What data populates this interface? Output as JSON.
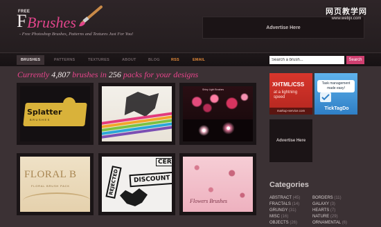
{
  "site": {
    "logo_free": "FREE",
    "logo_f": "F",
    "logo_rest": "Brushes",
    "tagline": "- Free Photoshop Brushes, Patterns and Textures Just For You!",
    "top_ad": "Advertise Here"
  },
  "watermark": {
    "cn": "网页教学网",
    "url": "www.webjx.com"
  },
  "nav": {
    "items": [
      {
        "label": "BRUSHES",
        "state": "active"
      },
      {
        "label": "PATTERNS",
        "state": "dim"
      },
      {
        "label": "TEXTURES",
        "state": "dim"
      },
      {
        "label": "ABOUT",
        "state": "dim"
      },
      {
        "label": "BLOG",
        "state": "dim"
      },
      {
        "label": "RSS",
        "state": "hot"
      },
      {
        "label": "EMAIL",
        "state": "hot"
      }
    ],
    "search_value": "Search a brush...",
    "search_button": "Search"
  },
  "main": {
    "heading_pre": "Currently ",
    "brush_count": "4,807",
    "heading_mid": " brushes in ",
    "pack_count": "256",
    "heading_post": " packs for your designs",
    "thumbs": [
      {
        "word": "Splatter",
        "sub": "BRUSHES"
      },
      {
        "word": ""
      },
      {
        "title": "Shiny Light Brushes"
      },
      {
        "word": "FLORAL B",
        "sub": "FLORAL BRUSH PACK"
      },
      {
        "stamp1": "REJECTED",
        "stamp2": "DISCOUNT",
        "stamp3": "CER"
      },
      {
        "word": "Flowers Brushes"
      }
    ]
  },
  "sidebar": {
    "ad1": {
      "title": "XHTML/CSS",
      "line1": "at a lightning",
      "line2": "speed",
      "footer": "markup-service.com"
    },
    "ad2": {
      "bubble_line1": "Task management",
      "bubble_line2": "made easy!",
      "name": "TickTagDo"
    },
    "ad3": "Advertise Here",
    "categories_title": "Categories",
    "categories": [
      {
        "name": "ABSTRACT",
        "count": "(45)"
      },
      {
        "name": "BORDERS",
        "count": "(11)"
      },
      {
        "name": "FRACTALS",
        "count": "(14)"
      },
      {
        "name": "GALAXY",
        "count": "(3)"
      },
      {
        "name": "GRUNGY",
        "count": "(31)"
      },
      {
        "name": "HEARTS",
        "count": "(7)"
      },
      {
        "name": "MISC",
        "count": "(16)"
      },
      {
        "name": "NATURE",
        "count": "(29)"
      },
      {
        "name": "OBJECTS",
        "count": "(26)"
      },
      {
        "name": "ORNAMENTAL",
        "count": "(6)"
      }
    ]
  },
  "colors": {
    "accent": "#e0458b",
    "background": "#231c1e",
    "panel": "#3b3134",
    "nav_hot": "#e58b3a",
    "search_button": "#cf3f70"
  }
}
